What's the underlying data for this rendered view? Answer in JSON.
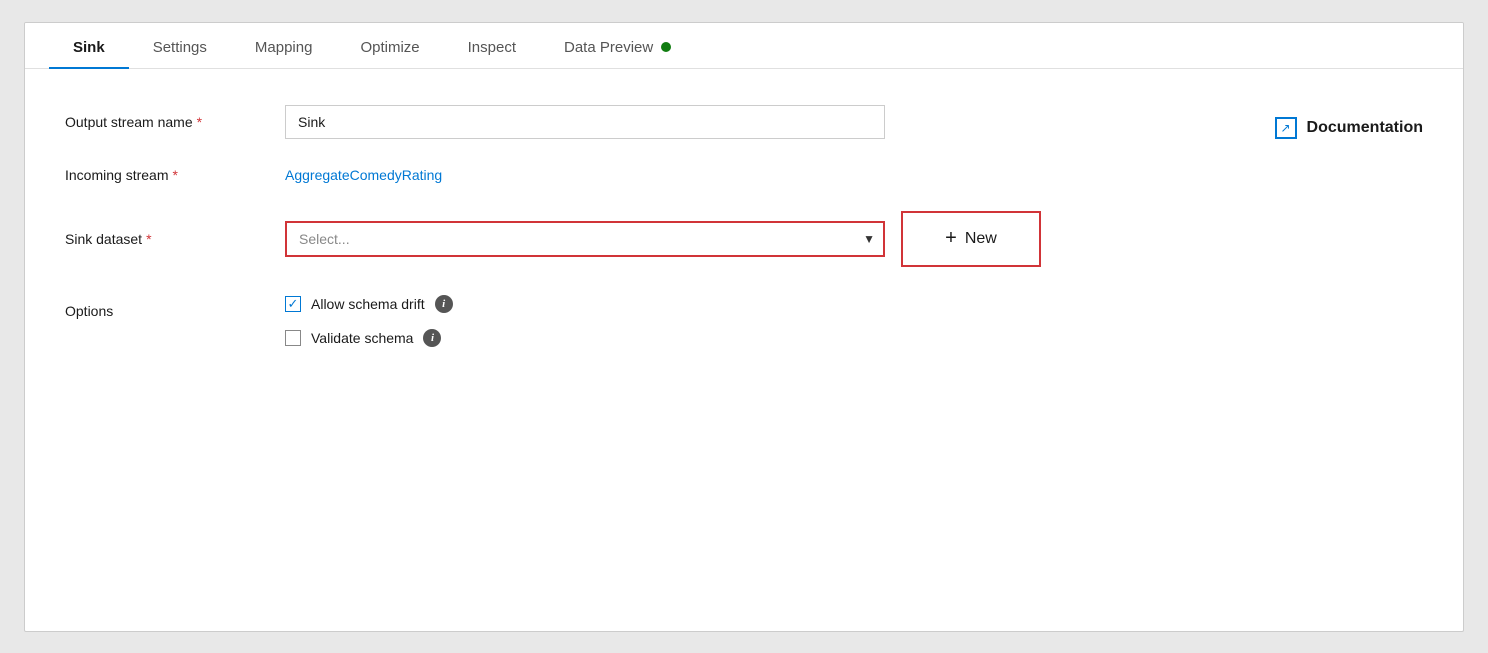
{
  "tabs": [
    {
      "id": "sink",
      "label": "Sink",
      "active": true
    },
    {
      "id": "settings",
      "label": "Settings",
      "active": false
    },
    {
      "id": "mapping",
      "label": "Mapping",
      "active": false
    },
    {
      "id": "optimize",
      "label": "Optimize",
      "active": false
    },
    {
      "id": "inspect",
      "label": "Inspect",
      "active": false
    },
    {
      "id": "data-preview",
      "label": "Data Preview",
      "active": false
    }
  ],
  "fields": {
    "output_stream_name_label": "Output stream name",
    "output_stream_name_value": "Sink",
    "incoming_stream_label": "Incoming stream",
    "incoming_stream_value": "AggregateComedyRating",
    "sink_dataset_label": "Sink dataset",
    "sink_dataset_placeholder": "Select...",
    "options_label": "Options",
    "allow_schema_drift_label": "Allow schema drift",
    "validate_schema_label": "Validate schema"
  },
  "buttons": {
    "new_label": "New",
    "new_plus": "+"
  },
  "documentation": {
    "label": "Documentation"
  },
  "icons": {
    "info": "i",
    "external_link": "↗",
    "dropdown_arrow": "▼",
    "checkmark": "✓"
  },
  "colors": {
    "active_tab_underline": "#0078d4",
    "link_color": "#0078d4",
    "required_star": "#d13438",
    "error_border": "#d13438",
    "dot_green": "#107c10"
  }
}
